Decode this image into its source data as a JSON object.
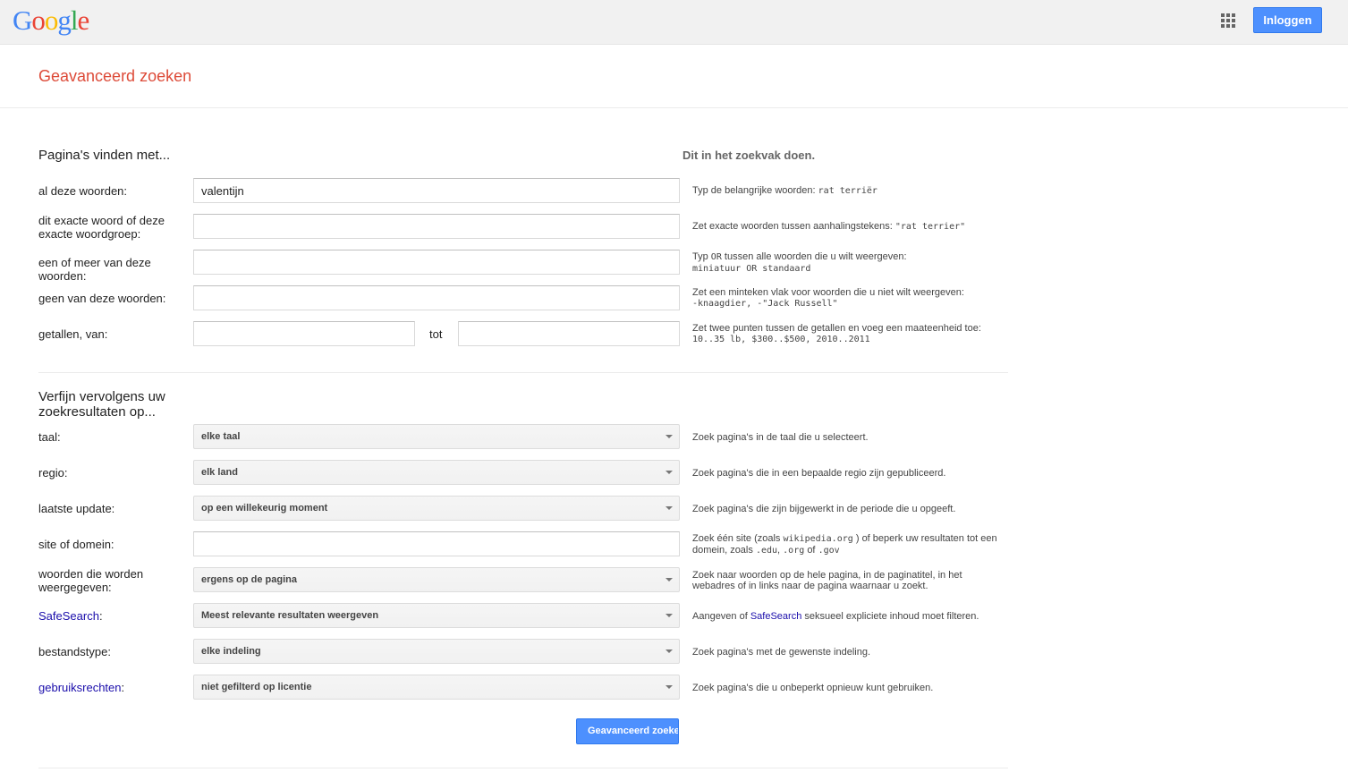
{
  "header": {
    "logo_letters": [
      {
        "ch": "G",
        "color": "#4285f4"
      },
      {
        "ch": "o",
        "color": "#ea4335"
      },
      {
        "ch": "o",
        "color": "#fbbc05"
      },
      {
        "ch": "g",
        "color": "#4285f4"
      },
      {
        "ch": "l",
        "color": "#34a853"
      },
      {
        "ch": "e",
        "color": "#ea4335"
      }
    ],
    "apps_icon": "apps-grid-icon",
    "signin_label": "Inloggen"
  },
  "page_title": "Geavanceerd zoeken",
  "find": {
    "heading": "Pagina's vinden met...",
    "side_heading": "Dit in het zoekvak doen.",
    "all_words": {
      "label": "al deze woorden:",
      "value": "valentijn",
      "hint_text": "Typ de belangrijke woorden:",
      "hint_code": "rat terriër"
    },
    "exact": {
      "label": "dit exacte woord of deze exacte woordgroep:",
      "value": "",
      "hint_text": "Zet exacte woorden tussen aanhalingstekens:",
      "hint_code": "\"rat terrier\""
    },
    "any": {
      "label": "een of meer van deze woorden:",
      "value": "",
      "hint_pre": "Typ",
      "hint_or": "OR",
      "hint_post": "tussen alle woorden die u wilt weergeven:",
      "hint_code": "miniatuur OR standaard"
    },
    "none": {
      "label": "geen van deze woorden:",
      "value": "",
      "hint_text": "Zet een minteken vlak voor woorden die u niet wilt weergeven:",
      "hint_code": "-knaagdier, -\"Jack Russell\""
    },
    "numbers": {
      "label": "getallen, van:",
      "from": "",
      "to_label": "tot",
      "to": "",
      "hint_text": "Zet twee punten tussen de getallen en voeg een maateenheid toe:",
      "hint_code": "10..35 lb, $300..$500, 2010..2011"
    }
  },
  "refine": {
    "heading": "Verfijn vervolgens uw zoekresultaten op...",
    "language": {
      "label": "taal:",
      "value": "elke taal",
      "hint": "Zoek pagina's in de taal die u selecteert."
    },
    "region": {
      "label": "regio:",
      "value": "elk land",
      "hint": "Zoek pagina's die in een bepaalde regio zijn gepubliceerd."
    },
    "last_update": {
      "label": "laatste update:",
      "value": "op een willekeurig moment",
      "hint": "Zoek pagina's die zijn bijgewerkt in de periode die u opgeeft."
    },
    "site": {
      "label": "site of domein:",
      "value": "",
      "hint_a": "Zoek één site (zoals",
      "hint_code1": "wikipedia.org",
      "hint_b": ") of beperk uw resultaten tot een domein, zoals",
      "hint_code2": ".edu",
      "hint_c": ",",
      "hint_code3": ".org",
      "hint_d": "of",
      "hint_code4": ".gov"
    },
    "terms": {
      "label": "woorden die worden weergegeven:",
      "value": "ergens op de pagina",
      "hint": "Zoek naar woorden op de hele pagina, in de paginatitel, in het webadres of in links naar de pagina waarnaar u zoekt."
    },
    "safesearch": {
      "label": "SafeSearch",
      "colon": ":",
      "value": "Meest relevante resultaten weergeven",
      "hint_a": "Aangeven of",
      "hint_link": "SafeSearch",
      "hint_b": "seksueel expliciete inhoud moet filteren."
    },
    "filetype": {
      "label": "bestandstype:",
      "value": "elke indeling",
      "hint": "Zoek pagina's met de gewenste indeling."
    },
    "rights": {
      "label": "gebruiksrechten",
      "colon": ":",
      "value": "niet gefilterd op licentie",
      "hint": "Zoek pagina's die u onbeperkt opnieuw kunt gebruiken."
    }
  },
  "submit_label": "Geavanceerd zoeken",
  "colors": {
    "accent": "#4d90fe",
    "title": "#dd4b39",
    "link": "#1a0dab"
  }
}
